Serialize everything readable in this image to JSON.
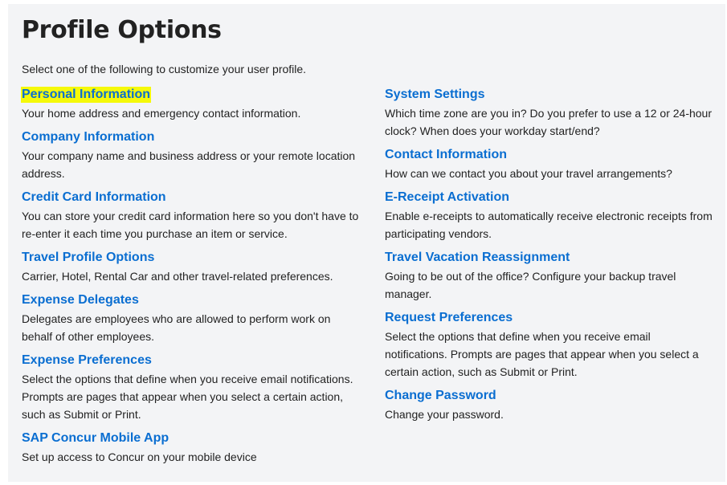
{
  "page": {
    "title": "Profile Options",
    "intro": "Select one of the following to customize your user profile.",
    "highlight_color": "#f5f90a",
    "link_color": "#0a6ed1"
  },
  "left_column": [
    {
      "label": "Personal Information",
      "description": "Your home address and emergency contact information."
    },
    {
      "label": "Company Information",
      "description": "Your company name and business address or your remote location address."
    },
    {
      "label": "Credit Card Information",
      "description": "You can store your credit card information here so you don't have to re-enter it each time you purchase an item or service."
    },
    {
      "label": "Travel Profile Options",
      "description": "Carrier, Hotel, Rental Car and other travel-related preferences."
    },
    {
      "label": "Expense Delegates",
      "description": "Delegates are employees who are allowed to perform work on behalf of other employees."
    },
    {
      "label": "Expense Preferences",
      "description": "Select the options that define when you receive email notifications. Prompts are pages that appear when you select a certain action, such as Submit or Print."
    },
    {
      "label": "SAP Concur Mobile App",
      "description": "Set up access to Concur on your mobile device"
    }
  ],
  "right_column": [
    {
      "label": "System Settings",
      "description": "Which time zone are you in? Do you prefer to use a 12 or 24-hour clock? When does your workday start/end?"
    },
    {
      "label": "Contact Information",
      "description": "How can we contact you about your travel arrangements?"
    },
    {
      "label": "E-Receipt Activation",
      "description": "Enable e-receipts to automatically receive electronic receipts from participating vendors."
    },
    {
      "label": "Travel Vacation Reassignment",
      "description": "Going to be out of the office? Configure your backup travel manager."
    },
    {
      "label": "Request Preferences",
      "description": "Select the options that define when you receive email notifications. Prompts are pages that appear when you select a certain action, such as Submit or Print."
    },
    {
      "label": "Change Password",
      "description": "Change your password."
    }
  ]
}
